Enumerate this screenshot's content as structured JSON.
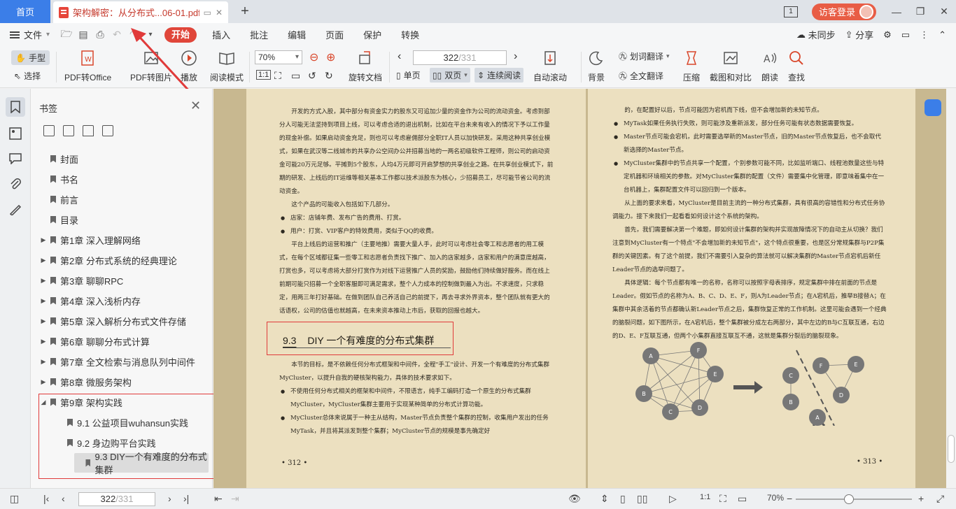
{
  "titlebar": {
    "home_tab": "首页",
    "doc_tab_title": "架构解密：从分布式...06-01.pdf",
    "new_tab": "+",
    "page_count_icon": "1",
    "guest_login": "访客登录"
  },
  "menubar": {
    "file": "文件",
    "items": [
      "开始",
      "插入",
      "批注",
      "编辑",
      "页面",
      "保护",
      "转换"
    ],
    "unsynced": "未同步",
    "share": "分享"
  },
  "toolbar": {
    "hand": "手型",
    "select": "选择",
    "pdf_to_office": "PDF转Office",
    "pdf_to_image": "PDF转图片",
    "play": "播放",
    "read_mode": "阅读模式",
    "zoom": "70%",
    "rotate_doc": "旋转文档",
    "page_current": "322",
    "page_total": "/331",
    "single_page": "单页",
    "double_page": "双页",
    "continuous": "连续阅读",
    "auto_scroll": "自动滚动",
    "background": "背景",
    "word_translate": "划词翻译",
    "full_translate": "全文翻译",
    "compress": "压缩",
    "screenshot_compare": "截图和对比",
    "read_aloud": "朗读",
    "find": "查找"
  },
  "bookmarks": {
    "title": "书签",
    "items": [
      {
        "label": "封面",
        "level": 0,
        "expand": ""
      },
      {
        "label": "书名",
        "level": 0,
        "expand": ""
      },
      {
        "label": "前言",
        "level": 0,
        "expand": ""
      },
      {
        "label": "目录",
        "level": 0,
        "expand": ""
      },
      {
        "label": "第1章 深入理解网络",
        "level": 0,
        "expand": "▶"
      },
      {
        "label": "第2章 分布式系统的经典理论",
        "level": 0,
        "expand": "▶"
      },
      {
        "label": "第3章 聊聊RPC",
        "level": 0,
        "expand": "▶"
      },
      {
        "label": "第4章 深入浅析内存",
        "level": 0,
        "expand": "▶"
      },
      {
        "label": "第5章 深入解析分布式文件存储",
        "level": 0,
        "expand": "▶"
      },
      {
        "label": "第6章 聊聊分布式计算",
        "level": 0,
        "expand": "▶"
      },
      {
        "label": "第7章 全文检索与消息队列中间件",
        "level": 0,
        "expand": "▶"
      },
      {
        "label": "第8章 微服务架构",
        "level": 0,
        "expand": "▶"
      },
      {
        "label": "第9章 架构实践",
        "level": 0,
        "expand": "◢"
      },
      {
        "label": "9.1 公益项目wuhansun实践",
        "level": 1,
        "expand": ""
      },
      {
        "label": "9.2 身边购平台实践",
        "level": 1,
        "expand": ""
      },
      {
        "label": "9.3 DIY一个有难度的分布式集群",
        "level": 1,
        "expand": "",
        "active": true
      }
    ]
  },
  "page_left": {
    "para_top": "开发的方式入股，其中部分有资金实力的股东又可追加少量的资金作为公司的流动资金。考虑到部分人可能无法坚持到项目上线，可以考虑合适的退出机制，比如在平台未来有收入的情况下予以工作量的现金补偿。如果启动资金充足，则也可以考虑雇佣部分全职IT人员以加快研发。采用这种共享创业模式，如果在武汉等二线城市的共享办公空间办公并招募当地的一两名初级软件工程师，则公司的启动资金可能20万元足够。平摊到5个股东，人均4万元即可开启梦想的共享创业之路。在共享创业模式下，前期的研发、上线后的IT运维等相关基本工作都以技术派股东为核心，少招募员工，尽可能节省公司的流动资金。",
    "income_intro": "这个产品的可能收入包括如下几部分。",
    "bullet_1": "店家：店铺年费、发布广告的费用、打赏。",
    "bullet_2": "用户：打赏、VIP客户的特效费用，类似于QQ的收费。",
    "para_ops": "平台上线后的运营和推广（主要地推）需要大量人手，此时可以考虑社会零工和志愿者的用工模式，在每个区域都征集一些零工和志愿者负责找下推广、加入的店家越多，店家和用户的满意度越高，打赏也多，可以考虑将大部分打赏作为对线下运营推广人员的奖励，鼓励他们持续做好服务。而在线上前期可能只招募一个全职客服即可满足需求，整个人力成本的控制做到最入为出。不求速度，只求稳定，用两三年打好基础。在做到团队自己养活自己的前提下，再去寻求外界资本，整个团队就有更大的话语权，公司的估值也就越高，在未来资本推动上市后，获取的回报也越大。",
    "section_num": "9.3",
    "section_title": "DIY 一个有难度的分布式集群",
    "para_goal": "本节的目标，是不依赖任何分布式框架和中间件，全程\"手工\"设计、开发一个有难度的分布式集群MyCluster，以提升自我的硬核架构能力，具体的技术要求如下。",
    "bullet_3": "不使用任何分布式相关的框架和中间件，不限语言，纯手工编码打造一个原生的分布式集群MyCluster，MyCluster集群主要用于实现某种简单的分布式计算功能。",
    "bullet_4": "MyCluster总体来说属于一种主从结构，Master节点负责整个集群的控制，收集用户发出的任务MyTask，并且将其派发到整个集群；MyCluster节点的规模是事先确定好",
    "page_num": "• 312 •"
  },
  "page_right": {
    "line_top": "的，在配置好以后，节点可能因为宕机而下线，但不会增加新的未知节点。",
    "bullet_1": "MyTask如果任务执行失败，则可能涉及重新派发，部分任务可能有状态数据需要恢复。",
    "bullet_2": "Master节点可能会宕机，此时需要选举新的Master节点，旧的Master节点恢复后，也不会取代新选择的Master节点。",
    "bullet_3": "MyCluster集群中的节点共享一个配置，个别参数可能不同，比如监听端口、线程池数量这些与特定机器和环境相关的参数。对MyCluster集群的配置（文件）需要集中化管理，即意味着集中在一台机器上，集群配置文件可以回归到一个版本。",
    "para_1": "从上面的要求来看，MyCluster是目前主流的一种分布式集群，具有很高的容错性和分布式任务协调能力。接下来我们一起看看如何设计这个系统的架构。",
    "para_2": "首先，我们需要解决第一个难题，即如何设计集群的架构并实现故障情况下的自动主从切换？我们注意到MyCluster有一个特点\"不会增加新的未知节点\"，这个特点很重要，也是区分常规集群与P2P集群的关键因素。有了这个前提，我们不需要引入复杂的算法就可以解决集群的Master节点宕机后新任Leader节点的选举问题了。",
    "para_3": "具体逻辑：每个节点都有唯一的名称，名称可以按照字母表排序，规定集群中排在前面的节点是Leader。假如节点的名称为A、B、C、D、E、F，则A为Leader节点；在A宕机后，推举B接替A；在集群中其余活着的节点都确认新Leader节点之后，集群恢复正常的工作机制。这里可能会遇到一个经典的脑裂问题，如下图所示，在A宕机后，整个集群被分成左右两部分，其中左边的B与C互联互通，右边的D、E、F互联互通，但两个小集群直接互联互不通，这就是集群分裂后的脑裂现象。",
    "nodes_left": [
      "A",
      "F",
      "E",
      "B",
      "C",
      "D"
    ],
    "nodes_right": [
      "C",
      "F",
      "E",
      "B",
      "D",
      "A"
    ],
    "page_num": "• 313 •"
  },
  "statusbar": {
    "page_current": "322",
    "page_total": "/331",
    "zoom": "70%"
  },
  "colors": {
    "accent_blue": "#3b7ee8",
    "accent_red": "#e0463a",
    "annotation_red": "#e03a3a",
    "page_bg": "#ece0c0"
  }
}
